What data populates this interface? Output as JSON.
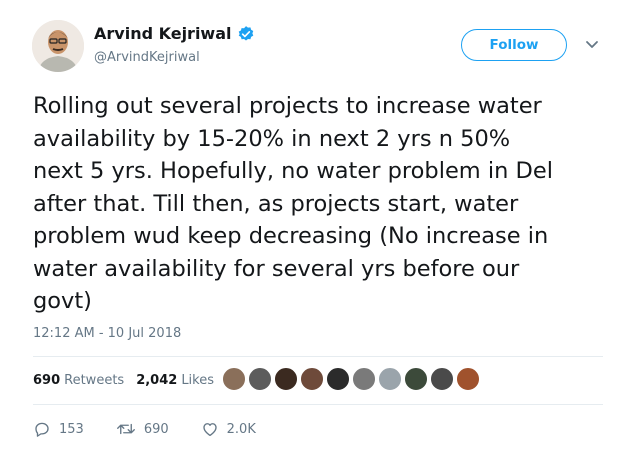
{
  "author": {
    "display_name": "Arvind Kejriwal",
    "handle": "@ArvindKejriwal",
    "verified": true
  },
  "follow_label": "Follow",
  "tweet_text": "Rolling out several projects to increase water\navailability by 15-20% in next 2 yrs n 50%\nnext 5 yrs. Hopefully, no water problem in Del\nafter that. Till then, as projects start, water\nproblem wud keep decreasing (No increase in\nwater availability for several yrs before our\ngovt)",
  "timestamp": "12:12 AM - 10 Jul 2018",
  "stats": {
    "retweets_count": "690",
    "retweets_label": "Retweets",
    "likes_count": "2,042",
    "likes_label": "Likes"
  },
  "likers": [
    {
      "name": "liker-avatar-1",
      "color": "#8a6f5a"
    },
    {
      "name": "liker-avatar-2",
      "color": "#5c5c5c"
    },
    {
      "name": "liker-avatar-3",
      "color": "#3b2a20"
    },
    {
      "name": "liker-avatar-4",
      "color": "#6e4a3a"
    },
    {
      "name": "liker-avatar-5",
      "color": "#2b2b2b"
    },
    {
      "name": "liker-avatar-6",
      "color": "#7a7a7a"
    },
    {
      "name": "liker-avatar-7",
      "color": "#9aa4ab"
    },
    {
      "name": "liker-avatar-8",
      "color": "#3c4a3a"
    },
    {
      "name": "liker-avatar-9",
      "color": "#4a4a4a"
    },
    {
      "name": "liker-avatar-10",
      "color": "#a0522d"
    }
  ],
  "actions": {
    "reply_count": "153",
    "retweet_count": "690",
    "like_count": "2.0K"
  },
  "colors": {
    "accent": "#1da1f2",
    "text": "#14171a",
    "secondary": "#657786",
    "divider": "#e6ecf0"
  },
  "icons": [
    "verified-badge-icon",
    "chevron-down-icon",
    "reply-icon",
    "retweet-icon",
    "heart-icon"
  ]
}
